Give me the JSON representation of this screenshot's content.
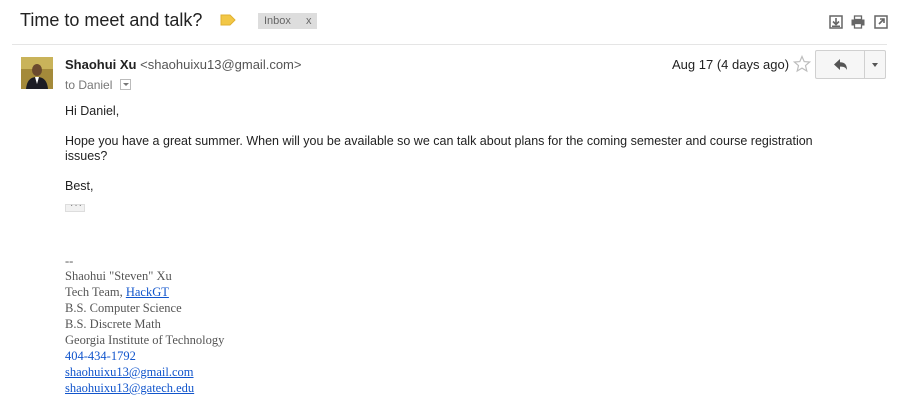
{
  "subject": "Time to meet and talk?",
  "labels": {
    "inbox": "Inbox",
    "remove": "x"
  },
  "colors": {
    "label_tag": "#f2c746",
    "link": "#1155cc",
    "avatar_bg": "#a48a3a"
  },
  "icons": {
    "archive": "download-icon",
    "print": "print-icon",
    "new_window": "open-in-new-window-icon",
    "star": "star-icon",
    "reply": "reply-icon",
    "more": "chevron-down-icon"
  },
  "message": {
    "sender_name": "Shaohui Xu",
    "sender_email": "<shaohuixu13@gmail.com>",
    "to_prefix": "to",
    "to_name": "Daniel",
    "date": "Aug 17 (4 days ago)",
    "greeting": "Hi Daniel,",
    "body_line1": "Hope you have a great summer. When will you be available so we can talk about plans for the coming semester and course registration",
    "body_line2": "issues?",
    "closing": "Best,",
    "ellipsis": "···"
  },
  "signature": {
    "separator": "--",
    "name": "Shaohui \"Steven\" Xu",
    "team_prefix": "Tech Team, ",
    "team_link": "HackGT",
    "degree1": "B.S. Computer Science",
    "degree2": "B.S. Discrete Math",
    "school": "Georgia Institute of Technology",
    "phone": "404-434-1792",
    "email1": "shaohuixu13@gmail.com",
    "email2": "shaohuixu13@gatech.edu"
  }
}
